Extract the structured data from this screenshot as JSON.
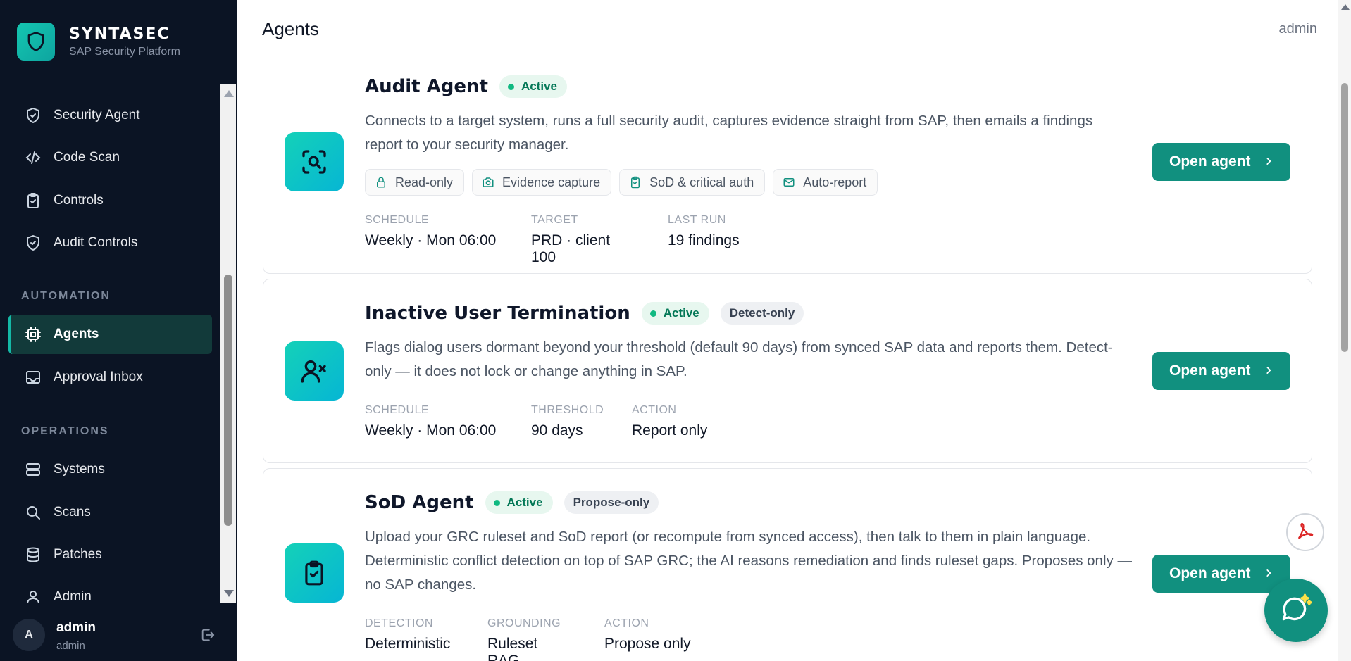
{
  "brand": {
    "name": "SYNTASEC",
    "subtitle": "SAP Security Platform"
  },
  "nav": {
    "items_top": [
      {
        "label": "Security Agent",
        "icon": "shield-check-icon"
      },
      {
        "label": "Code Scan",
        "icon": "code-icon"
      },
      {
        "label": "Controls",
        "icon": "clipboard-check-icon"
      },
      {
        "label": "Audit Controls",
        "icon": "shield-check-icon"
      }
    ],
    "section_automation": "AUTOMATION",
    "items_automation": [
      {
        "label": "Agents",
        "icon": "cpu-icon",
        "active": true
      },
      {
        "label": "Approval Inbox",
        "icon": "inbox-icon"
      }
    ],
    "section_operations": "OPERATIONS",
    "items_operations": [
      {
        "label": "Systems",
        "icon": "server-icon"
      },
      {
        "label": "Scans",
        "icon": "search-icon"
      },
      {
        "label": "Patches",
        "icon": "database-icon"
      },
      {
        "label": "Admin",
        "icon": "users-icon"
      }
    ]
  },
  "user": {
    "initial": "A",
    "name": "admin",
    "role": "admin"
  },
  "header": {
    "title": "Agents",
    "user": "admin"
  },
  "cards": [
    {
      "title": "Audit Agent",
      "status": "Active",
      "mode": "",
      "description": "Connects to a target system, runs a full security audit, captures evidence straight from SAP, then emails a findings report to your security manager.",
      "chips": [
        {
          "label": "Read-only",
          "icon": "lock-icon"
        },
        {
          "label": "Evidence capture",
          "icon": "camera-icon"
        },
        {
          "label": "SoD & critical auth",
          "icon": "clipboard-check-icon"
        },
        {
          "label": "Auto-report",
          "icon": "mail-icon"
        }
      ],
      "meta": [
        {
          "label": "SCHEDULE",
          "value": "Weekly · Mon 06:00"
        },
        {
          "label": "TARGET",
          "value": "PRD · client 100"
        },
        {
          "label": "LAST RUN",
          "value": "19 findings"
        }
      ],
      "button": "Open agent"
    },
    {
      "title": "Inactive User Termination",
      "status": "Active",
      "mode": "Detect-only",
      "description": "Flags dialog users dormant beyond your threshold (default 90 days) from synced SAP data and reports them. Detect-only — it does not lock or change anything in SAP.",
      "meta": [
        {
          "label": "SCHEDULE",
          "value": "Weekly · Mon 06:00"
        },
        {
          "label": "THRESHOLD",
          "value": "90 days"
        },
        {
          "label": "ACTION",
          "value": "Report only"
        }
      ],
      "button": "Open agent"
    },
    {
      "title": "SoD Agent",
      "status": "Active",
      "mode": "Propose-only",
      "description": "Upload your GRC ruleset and SoD report (or recompute from synced access), then talk to them in plain language. Deterministic conflict detection on top of SAP GRC; the AI reasons remediation and finds ruleset gaps. Proposes only — no SAP changes.",
      "meta": [
        {
          "label": "DETECTION",
          "value": "Deterministic"
        },
        {
          "label": "GROUNDING",
          "value": "Ruleset RAG"
        },
        {
          "label": "ACTION",
          "value": "Propose only"
        }
      ],
      "button": "Open agent"
    }
  ],
  "colors": {
    "sidebar_bg": "#0b1424",
    "accent": "#11907f",
    "active_green": "#10b981"
  }
}
